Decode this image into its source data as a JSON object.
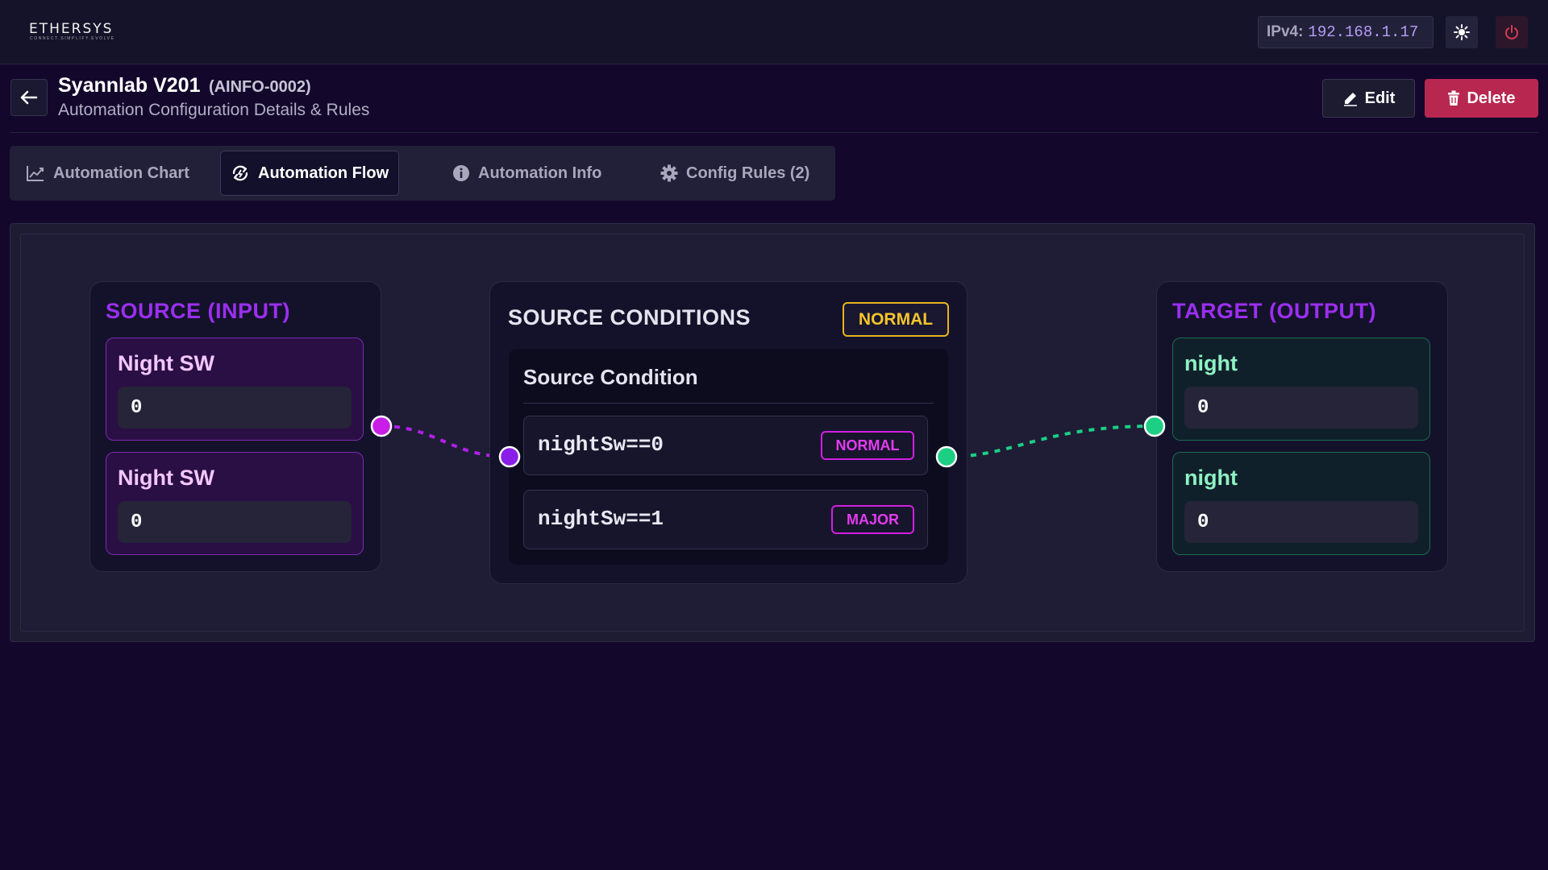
{
  "app": {
    "logo_text": "ETHERSYS",
    "logo_tagline": "CONNECT.SIMPLIFY.EVOLVE",
    "ip_label": "IPv4:",
    "ip_value": "192.168.1.17",
    "sun_icon": "sun-icon",
    "power_icon": "power-icon",
    "power_color": "#d33b55"
  },
  "header": {
    "title": "Syannlab V201",
    "code": "(AINFO-0002)",
    "subtitle": "Automation Configuration Details & Rules",
    "edit_label": "Edit",
    "delete_label": "Delete",
    "delete_color": "#b8274f"
  },
  "tabs": [
    {
      "label": "Automation Chart",
      "icon": "line-chart-icon",
      "active": false
    },
    {
      "label": "Automation Flow",
      "icon": "flow-sync-icon",
      "active": true
    },
    {
      "label": "Automation Info",
      "icon": "info-icon",
      "active": false
    },
    {
      "label": "Config Rules (2)",
      "icon": "gear-icon",
      "active": false
    }
  ],
  "flow": {
    "source": {
      "title": "SOURCE (INPUT)",
      "color": "#9b2ff0",
      "items": [
        {
          "name": "Night SW",
          "value": "0"
        },
        {
          "name": "Night SW",
          "value": "0"
        }
      ]
    },
    "conditions": {
      "title": "SOURCE CONDITIONS",
      "status": "NORMAL",
      "subheader": "Source Condition",
      "rows": [
        {
          "expr": "nightSw==0",
          "level": "NORMAL"
        },
        {
          "expr": "nightSw==1",
          "level": "MAJOR"
        }
      ]
    },
    "target": {
      "title": "TARGET (OUTPUT)",
      "color": "#9b2ff0",
      "items": [
        {
          "name": "night",
          "value": "0"
        },
        {
          "name": "night",
          "value": "0"
        }
      ]
    },
    "connector_colors": {
      "source": "#b020e8",
      "target": "#1ccf85"
    }
  }
}
